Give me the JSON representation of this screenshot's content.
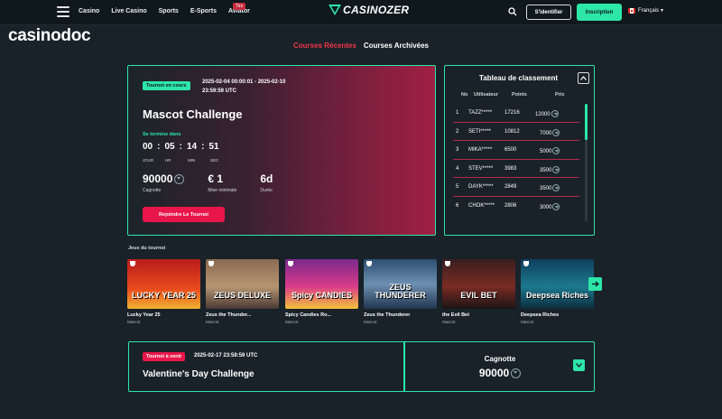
{
  "header": {
    "nav": [
      "Casino",
      "Live Casino",
      "Sports",
      "E-Sports",
      "Aviator"
    ],
    "nav_badge": "Tirs",
    "logo": "CASINOZER",
    "login": "S'identifier",
    "signup": "Inscription",
    "language": "Français"
  },
  "watermark": "casinodoc",
  "tabs": {
    "recent": "Courses Récentes",
    "archived": "Courses Archivées"
  },
  "tournament": {
    "status": "Tournoi en cours",
    "dates": "2025-02-04 00:00:01 - 2025-02-10 23:59:59 UTC",
    "title": "Mascot Challenge",
    "ends_label": "Se termine dans",
    "countdown": {
      "days": "00",
      "hours": "05",
      "minutes": "14",
      "seconds": "51"
    },
    "countdown_labels": {
      "days": "JOUR",
      "hours": "HR",
      "minutes": "MIN",
      "seconds": "SEC"
    },
    "stats": [
      {
        "value": "90000",
        "label": "Cagnotte"
      },
      {
        "value": "€ 1",
        "label": "Mise minimale"
      },
      {
        "value": "6d",
        "label": "Durée"
      }
    ],
    "join_label": "Rejoindre Le Tournoi"
  },
  "leaderboard": {
    "title": "Tableau de classement",
    "headers": {
      "no": "No",
      "user": "Utilisateur",
      "points": "Points",
      "prize": "Prix"
    },
    "rows": [
      {
        "no": "1",
        "user": "TAZZ*****",
        "points": "17216",
        "prize": "12000"
      },
      {
        "no": "2",
        "user": "SETI*****",
        "points": "10812",
        "prize": "7000"
      },
      {
        "no": "3",
        "user": "MIKA*****",
        "points": "6500",
        "prize": "5000"
      },
      {
        "no": "4",
        "user": "STEV*****",
        "points": "3983",
        "prize": "3500"
      },
      {
        "no": "5",
        "user": "DAYK*****",
        "points": "2849",
        "prize": "3500"
      },
      {
        "no": "6",
        "user": "CHOK*****",
        "points": "2806",
        "prize": "3000"
      }
    ]
  },
  "games": {
    "title": "Jeux du tournoi",
    "items": [
      {
        "name": "Lucky Year 25",
        "provider": "Mascot",
        "art": "LUCKY YEAR 25",
        "bg": "linear-gradient(180deg,#b81c1c,#e94b1d 60%,#f2b233)"
      },
      {
        "name": "Zeus the Thunder...",
        "provider": "Mascot",
        "art": "ZEUS DELUXE",
        "bg": "linear-gradient(180deg,#8a6a52,#b79572 55%,#4a3a34)"
      },
      {
        "name": "Spicy Candies Ro...",
        "provider": "Mascot",
        "art": "Spicy CANDIES",
        "bg": "linear-gradient(180deg,#7a2a8c,#d93b8a 55%,#f2c23a)"
      },
      {
        "name": "Zeus the Thunderer",
        "provider": "Mascot",
        "art": "ZEUS THUNDERER",
        "bg": "linear-gradient(180deg,#2c4f73,#6d8fb0 50%,#22364f)"
      },
      {
        "name": "the Evil Bet",
        "provider": "Mascot",
        "art": "EVIL BET",
        "bg": "linear-gradient(180deg,#3a1f1f,#7a2b24 55%,#1c1414)"
      },
      {
        "name": "Deepsea Riches",
        "provider": "Mascot",
        "art": "Deepsea Riches",
        "bg": "linear-gradient(180deg,#0f3e5e,#1c7a8f 55%,#0d2b3d)"
      }
    ]
  },
  "upcoming": {
    "status": "Tournoi à venir",
    "date": "2025-02-17 23:59:59 UTC",
    "title": "Valentine's Day Challenge",
    "jackpot_label": "Cagnotte",
    "jackpot_value": "90000"
  },
  "colors": {
    "accent": "#2ee6a8",
    "danger": "#e8164a",
    "bg": "#182228"
  }
}
